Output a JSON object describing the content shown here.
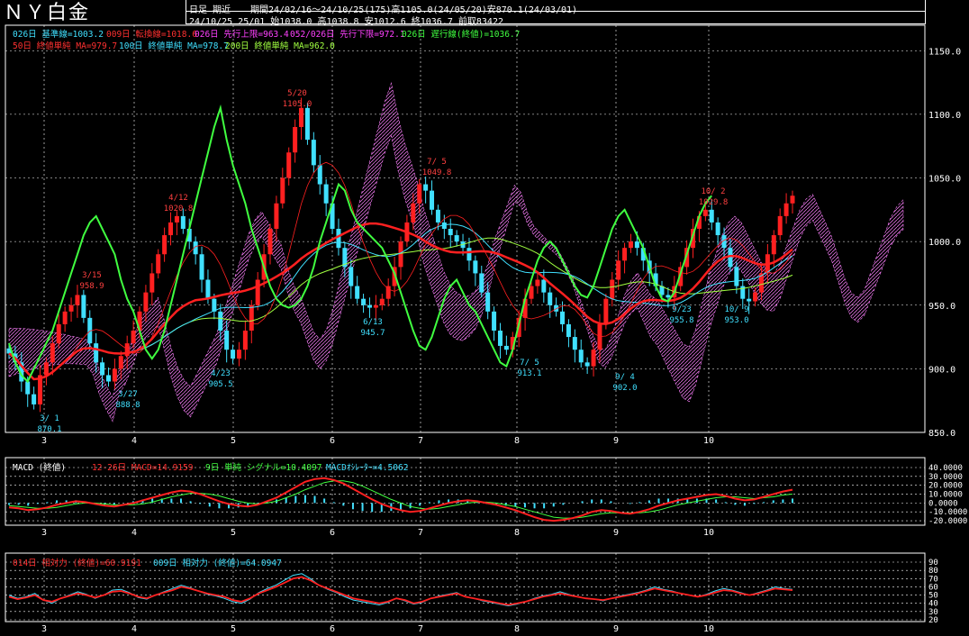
{
  "header": {
    "title": "ＮＹ白金",
    "mode": "日足 期近",
    "period": "期間24/02/16〜24/10/25(175)高1105.0(24/05/20)安870.1(24/03/01)",
    "ohlc": "24/10/25 25/01 始1038.0 高1038.8 安1012.6 終1036.7 前取83422"
  },
  "legend": {
    "kijun": "026日 基準線=1003.2",
    "tenkan": "009日 転換線=1018.6",
    "senko_a": "026日 先行上限=963.4",
    "senko_b": "052/026日 先行下限=972.1",
    "chikou": "026日 遅行線(終値)=1036.7",
    "ma50": "50日 終値単純 MA=979.7",
    "ma100": "100日 終値単純 MA=978.7",
    "ma200": "200日 終値単純 MA=962.0",
    "macd": "MACD (終値)",
    "macd_params": "12-26日 MACD=14.9159",
    "signal": "9日 単純 シグナル=10.4097",
    "oscillator": "MACDｵｼﾚｰﾀｰ=4.5062",
    "rsi14": "014日 相対力 (終値)=60.9191",
    "rsi9": "009日 相対力 (終値)=64.0947"
  },
  "colors": {
    "up": "#ff2020",
    "down": "#40e0ff",
    "kijun": "#ff40ff",
    "tenkan": "#ff2020",
    "chikou": "#40ff40",
    "ma50": "#ff2020",
    "ma100": "#40e0ff",
    "ma200": "#a0ff40",
    "grid": "#ffffff",
    "annot_high": "#ff4040",
    "annot_low": "#40e0ff",
    "cloud": "#ff80ff"
  },
  "chart_data": [
    {
      "type": "candlestick",
      "title": "ＮＹ白金",
      "x_ticks": [
        "3",
        "4",
        "5",
        "6",
        "7",
        "8",
        "9",
        "10"
      ],
      "y_ticks": [
        "850.0",
        "900.0",
        "950.0",
        "1000.0",
        "1050.0",
        "1100.0",
        "1150.0"
      ],
      "ylim": [
        850,
        1170
      ],
      "annotations": [
        {
          "date": "3/15",
          "value": "958.9",
          "kind": "high"
        },
        {
          "date": "4/12",
          "value": "1020.8",
          "kind": "high"
        },
        {
          "date": "5/20",
          "value": "1105.0",
          "kind": "high"
        },
        {
          "date": "7/ 5",
          "value": "1049.8",
          "kind": "high"
        },
        {
          "date": "10/ 2",
          "value": "1029.8",
          "kind": "high"
        },
        {
          "date": "3/ 1",
          "value": "870.1",
          "kind": "low"
        },
        {
          "date": "3/27",
          "value": "888.8",
          "kind": "low"
        },
        {
          "date": "4/23",
          "value": "905.5",
          "kind": "low"
        },
        {
          "date": "6/13",
          "value": "945.7",
          "kind": "low"
        },
        {
          "date": "7/ 5",
          "value": "913.1",
          "kind": "low"
        },
        {
          "date": "9/ 4",
          "value": "902.0",
          "kind": "low"
        },
        {
          "date": "9/23",
          "value": "955.8",
          "kind": "low"
        },
        {
          "date": "10/ 9",
          "value": "953.0",
          "kind": "low"
        }
      ],
      "candles_close": [
        912,
        905,
        890,
        880,
        872,
        895,
        905,
        920,
        935,
        945,
        950,
        958,
        940,
        920,
        905,
        895,
        890,
        900,
        910,
        920,
        930,
        945,
        960,
        975,
        990,
        1005,
        1015,
        1020,
        1010,
        1000,
        990,
        970,
        955,
        945,
        930,
        915,
        908,
        915,
        930,
        950,
        970,
        990,
        1010,
        1030,
        1050,
        1070,
        1090,
        1105,
        1080,
        1060,
        1045,
        1030,
        1010,
        995,
        980,
        965,
        955,
        950,
        948,
        950,
        955,
        965,
        980,
        1000,
        1015,
        1030,
        1045,
        1040,
        1025,
        1015,
        1010,
        1005,
        1000,
        995,
        985,
        975,
        960,
        945,
        930,
        918,
        915,
        925,
        940,
        955,
        965,
        970,
        960,
        950,
        945,
        935,
        925,
        915,
        905,
        902,
        915,
        935,
        955,
        970,
        985,
        995,
        1000,
        995,
        985,
        975,
        965,
        958,
        956,
        965,
        980,
        995,
        1010,
        1020,
        1025,
        1015,
        1005,
        995,
        980,
        965,
        955,
        953,
        960,
        975,
        990,
        1005,
        1020,
        1030,
        1036
      ]
    },
    {
      "type": "line",
      "title": "MACD (終値)",
      "y_ticks": [
        "40.0000",
        "30.0000",
        "20.0000",
        "10.0000",
        "0.0000",
        "-10.0000",
        "-20.0000"
      ],
      "ylim": [
        -25,
        40
      ],
      "series": [
        {
          "name": "MACD",
          "values": [
            -5,
            -6,
            -8,
            -7,
            -5,
            -2,
            0,
            2,
            1,
            -1,
            -3,
            -4,
            -2,
            0,
            3,
            6,
            9,
            12,
            14,
            13,
            10,
            6,
            2,
            -1,
            -3,
            -4,
            -2,
            2,
            6,
            12,
            18,
            24,
            27,
            28,
            26,
            22,
            16,
            10,
            4,
            -1,
            -5,
            -8,
            -10,
            -9,
            -6,
            -3,
            0,
            2,
            3,
            2,
            0,
            -2,
            -5,
            -8,
            -12,
            -16,
            -19,
            -20,
            -19,
            -17,
            -14,
            -10,
            -8,
            -9,
            -11,
            -12,
            -10,
            -7,
            -3,
            0,
            3,
            5,
            7,
            9,
            10,
            8,
            5,
            3,
            4,
            7,
            10,
            13,
            15
          ]
        },
        {
          "name": "シグナル",
          "values": [
            -3,
            -4,
            -5,
            -6,
            -6,
            -5,
            -3,
            -1,
            0,
            0,
            -1,
            -2,
            -2,
            -2,
            -1,
            1,
            4,
            7,
            9,
            11,
            11,
            10,
            8,
            5,
            2,
            0,
            -1,
            0,
            2,
            6,
            10,
            15,
            19,
            23,
            25,
            25,
            23,
            19,
            14,
            9,
            4,
            0,
            -4,
            -6,
            -7,
            -6,
            -4,
            -2,
            0,
            1,
            1,
            0,
            -2,
            -4,
            -7,
            -10,
            -13,
            -16,
            -17,
            -17,
            -16,
            -14,
            -12,
            -11,
            -11,
            -11,
            -11,
            -10,
            -8,
            -5,
            -2,
            0,
            2,
            4,
            6,
            7,
            7,
            6,
            5,
            6,
            7,
            9,
            10
          ]
        }
      ]
    },
    {
      "type": "line",
      "title": "相対力 (終値)",
      "y_ticks": [
        "90",
        "80",
        "70",
        "60",
        "50",
        "40",
        "30",
        "20"
      ],
      "ylim": [
        20,
        90
      ],
      "series": [
        {
          "name": "014日 相対力",
          "values": [
            48,
            45,
            47,
            50,
            44,
            42,
            46,
            49,
            52,
            50,
            47,
            50,
            54,
            55,
            52,
            48,
            46,
            50,
            53,
            56,
            60,
            58,
            55,
            52,
            50,
            48,
            44,
            42,
            46,
            52,
            56,
            60,
            65,
            70,
            72,
            68,
            62,
            58,
            54,
            50,
            46,
            44,
            42,
            40,
            42,
            46,
            44,
            40,
            42,
            46,
            48,
            50,
            52,
            48,
            46,
            44,
            42,
            40,
            38,
            40,
            42,
            45,
            48,
            50,
            52,
            50,
            48,
            46,
            45,
            44,
            46,
            48,
            50,
            52,
            55,
            58,
            56,
            54,
            52,
            50,
            48,
            50,
            53,
            56,
            55,
            52,
            50,
            52,
            55,
            58,
            57,
            56
          ]
        },
        {
          "name": "009日 相対力",
          "values": [
            50,
            46,
            48,
            52,
            44,
            40,
            46,
            50,
            54,
            51,
            46,
            50,
            56,
            57,
            53,
            47,
            45,
            50,
            54,
            58,
            62,
            59,
            55,
            51,
            49,
            46,
            42,
            40,
            45,
            53,
            58,
            62,
            68,
            74,
            76,
            70,
            62,
            57,
            53,
            48,
            44,
            42,
            40,
            38,
            41,
            46,
            43,
            39,
            41,
            46,
            49,
            51,
            53,
            48,
            46,
            43,
            41,
            39,
            37,
            39,
            42,
            46,
            49,
            51,
            54,
            51,
            48,
            46,
            45,
            43,
            46,
            49,
            51,
            53,
            56,
            60,
            57,
            55,
            52,
            50,
            48,
            51,
            55,
            58,
            56,
            53,
            50,
            53,
            56,
            60,
            58,
            57
          ]
        }
      ]
    }
  ]
}
